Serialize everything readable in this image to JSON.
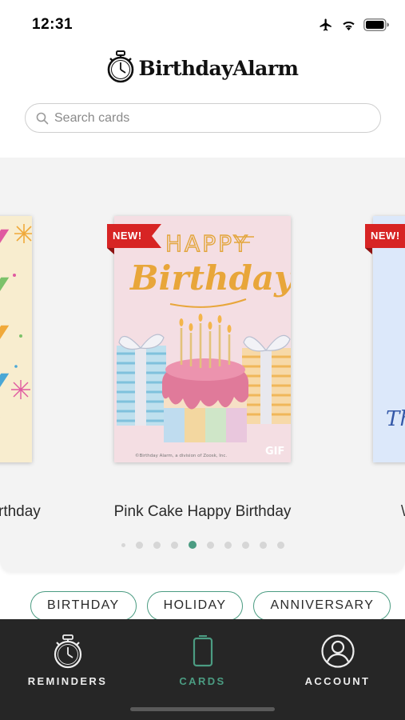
{
  "status_bar": {
    "time": "12:31",
    "icons": [
      "airplane-icon",
      "wifi-icon",
      "battery-icon"
    ]
  },
  "app": {
    "logo_text": "BirthdayAlarm",
    "logo_icon": "stopwatch-icon"
  },
  "search": {
    "placeholder": "Search cards",
    "value": ""
  },
  "carousel": {
    "cards": [
      {
        "title": "Happy Birthday",
        "visible_title": "rthday",
        "badge": "",
        "partial": "left"
      },
      {
        "title": "Pink Cake Happy Birthday",
        "badge": "NEW!",
        "gif_label": "GIF",
        "card_text_1": "HAPPY",
        "card_text_2": "Birthday",
        "copyright": "©Birthday Alarm, a division of Zoosk, Inc.",
        "partial": "none"
      },
      {
        "title": "Thank You",
        "visible_title": "\\",
        "card_text": "Th",
        "badge": "NEW!",
        "partial": "right"
      }
    ],
    "page_count": 10,
    "active_index": 4
  },
  "categories": [
    {
      "label": "BIRTHDAY"
    },
    {
      "label": "HOLIDAY"
    },
    {
      "label": "ANNIVERSARY"
    }
  ],
  "tabbar": {
    "tabs": [
      {
        "label": "REMINDERS",
        "icon": "stopwatch-icon",
        "active": false
      },
      {
        "label": "CARDS",
        "icon": "card-icon",
        "active": true
      },
      {
        "label": "ACCOUNT",
        "icon": "user-icon",
        "active": false
      }
    ]
  },
  "colors": {
    "accent": "#4b9c82",
    "badge_red": "#d72424",
    "tabbar_bg": "#262626",
    "carousel_bg": "#f3f3f3"
  }
}
